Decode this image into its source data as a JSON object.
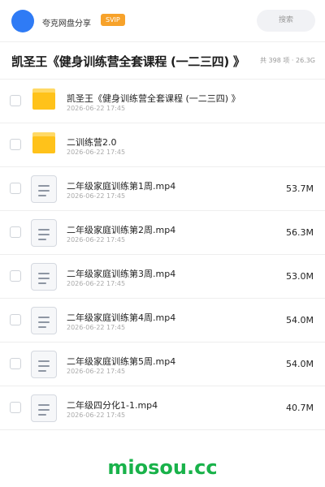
{
  "header": {
    "brand": "夸克网盘分享",
    "badge": "SVIP",
    "search_placeholder": "搜索"
  },
  "share": {
    "title": "凯圣王《健身训练营全套课程 (一二三四) 》",
    "meta": "共 398 项 · 26.3G"
  },
  "files": [
    {
      "type": "folder",
      "name": "凯圣王《健身训练营全套课程 (一二三四) 》",
      "date": "2026-06-22 17:45",
      "size": ""
    },
    {
      "type": "folder",
      "name": "二训练营2.0",
      "date": "2026-06-22 17:45",
      "size": ""
    },
    {
      "type": "file",
      "name": "二年级家庭训练第1周.mp4",
      "date": "2026-06-22 17:45",
      "size": "53.7M"
    },
    {
      "type": "file",
      "name": "二年级家庭训练第2周.mp4",
      "date": "2026-06-22 17:45",
      "size": "56.3M"
    },
    {
      "type": "file",
      "name": "二年级家庭训练第3周.mp4",
      "date": "2026-06-22 17:45",
      "size": "53.0M"
    },
    {
      "type": "file",
      "name": "二年级家庭训练第4周.mp4",
      "date": "2026-06-22 17:45",
      "size": "54.0M"
    },
    {
      "type": "file",
      "name": "二年级家庭训练第5周.mp4",
      "date": "2026-06-22 17:45",
      "size": "54.0M"
    },
    {
      "type": "file",
      "name": "二年级四分化1-1.mp4",
      "date": "2026-06-22 17:45",
      "size": "40.7M"
    }
  ],
  "watermark": "miosou.cc",
  "colors": {
    "avatar": "#2f7bf5",
    "badge": "#f7a22a",
    "folder": "#ffc21a",
    "watermark": "#19b24a"
  }
}
